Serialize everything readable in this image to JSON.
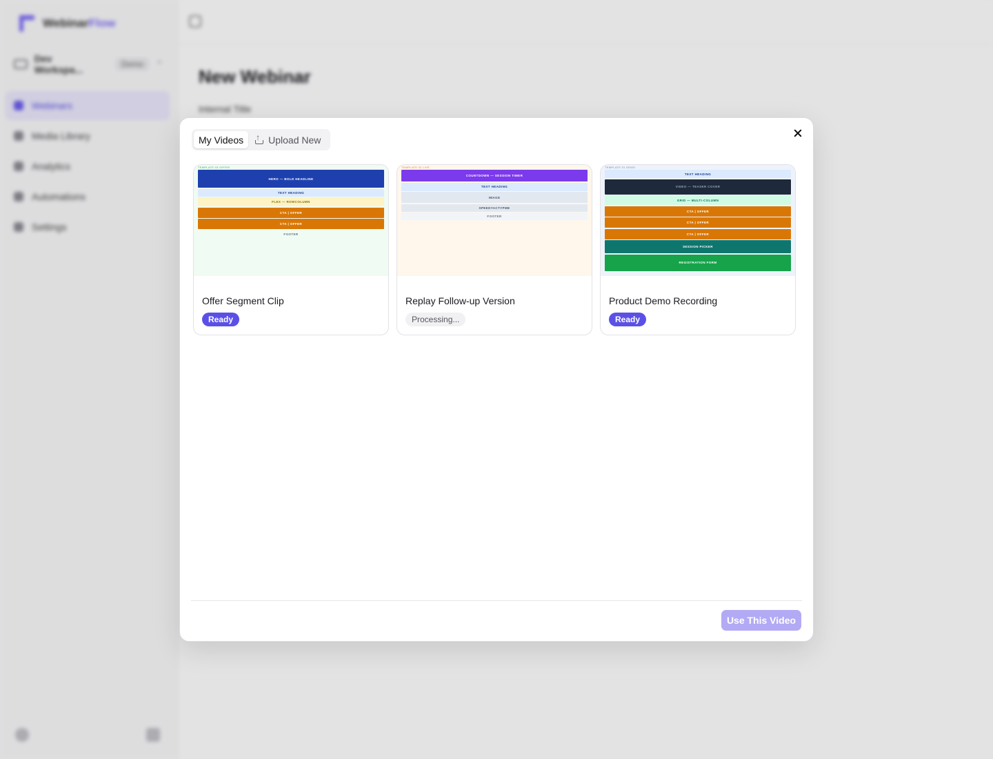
{
  "app": {
    "brand_first": "Webinar",
    "brand_second": "Flow",
    "workspace_name": "Dev Workspa...",
    "workspace_badge": "Demo",
    "nav": [
      {
        "label": "Webinars",
        "active": true
      },
      {
        "label": "Media Library",
        "active": false
      },
      {
        "label": "Analytics",
        "active": false
      },
      {
        "label": "Automations",
        "active": false
      },
      {
        "label": "Settings",
        "active": false
      }
    ],
    "page_title": "New Webinar",
    "field_label": "Internal Title"
  },
  "modal": {
    "tabs": [
      {
        "label": "My Videos",
        "active": true
      },
      {
        "label": "Upload New",
        "active": false,
        "icon": "upload-icon"
      }
    ],
    "primary_button": "Use This Video",
    "colors": {
      "accent": "#5b50e6",
      "accent_disabled": "#b2aaf4"
    },
    "videos": [
      {
        "title": "Offer Segment Clip",
        "status": "Ready",
        "thumb_bg": "#f0fbf3",
        "thumb_label": "TEMPLATE 03 OFFER",
        "thumb_label_color": "#3bb26b",
        "blocks": [
          {
            "text": "HERO — BOLD HEADLINE",
            "bg": "#1e40af",
            "fg": "#ffffff",
            "h": 26
          },
          {
            "text": "TEXT HEADING",
            "bg": "#dbeafe",
            "fg": "#1e3a8a",
            "h": 11
          },
          {
            "text": "FLEX — ROWCOLUMN",
            "bg": "#fdf3c4",
            "fg": "#8a6d00",
            "h": 13
          },
          {
            "text": "CTA | OFFER",
            "bg": "#d97706",
            "fg": "#ffffff",
            "h": 15
          },
          {
            "text": "CTA | OFFER",
            "bg": "#d97706",
            "fg": "#ffffff",
            "h": 15
          },
          {
            "text": "FOOTER",
            "bg": "transparent",
            "fg": "#667085",
            "h": 11
          }
        ]
      },
      {
        "title": "Replay Follow-up Version",
        "status": "Processing...",
        "thumb_bg": "#fff6ec",
        "thumb_label": "TEMPLATE 02 LIVE",
        "thumb_label_color": "#e08a3c",
        "blocks": [
          {
            "text": "COUNTDOWN — SESSION TIMER",
            "bg": "#7c3aed",
            "fg": "#ffffff",
            "h": 17
          },
          {
            "text": "TEXT HEADING",
            "bg": "#dbeafe",
            "fg": "#1e3a8a",
            "h": 12
          },
          {
            "text": "IMAGE",
            "bg": "#e2e8f0",
            "fg": "#475569",
            "h": 16
          },
          {
            "text": "SPEEDYACTYPME",
            "bg": "#e2e8f0",
            "fg": "#475569",
            "h": 11
          },
          {
            "text": "FOOTER",
            "bg": "#f1f5f9",
            "fg": "#667085",
            "h": 11
          }
        ]
      },
      {
        "title": "Product Demo Recording",
        "status": "Ready",
        "thumb_bg": "#eef3fb",
        "thumb_label": "TEMPLATE 01 DEMO",
        "thumb_label_color": "#7b8ba8",
        "blocks": [
          {
            "text": "TEXT HEADING",
            "bg": "#dbeafe",
            "fg": "#1e3a8a",
            "h": 12
          },
          {
            "text": "VIDEO — TEASER COVER",
            "bg": "#1e293b",
            "fg": "#94a3b8",
            "h": 22
          },
          {
            "text": "GRID — MULTI-COLUMN",
            "bg": "#d1fae5",
            "fg": "#047857",
            "h": 14
          },
          {
            "text": "CTA | OFFER",
            "bg": "#d97706",
            "fg": "#ffffff",
            "h": 15
          },
          {
            "text": "CTA | OFFER",
            "bg": "#d97706",
            "fg": "#ffffff",
            "h": 15
          },
          {
            "text": "CTA | OFFER",
            "bg": "#d97706",
            "fg": "#ffffff",
            "h": 15
          },
          {
            "text": "SESSION PICKER",
            "bg": "#0f766e",
            "fg": "#ffffff",
            "h": 19
          },
          {
            "text": "REGISTRATION FORM",
            "bg": "#16a34a",
            "fg": "#ffffff",
            "h": 24
          }
        ]
      }
    ]
  }
}
